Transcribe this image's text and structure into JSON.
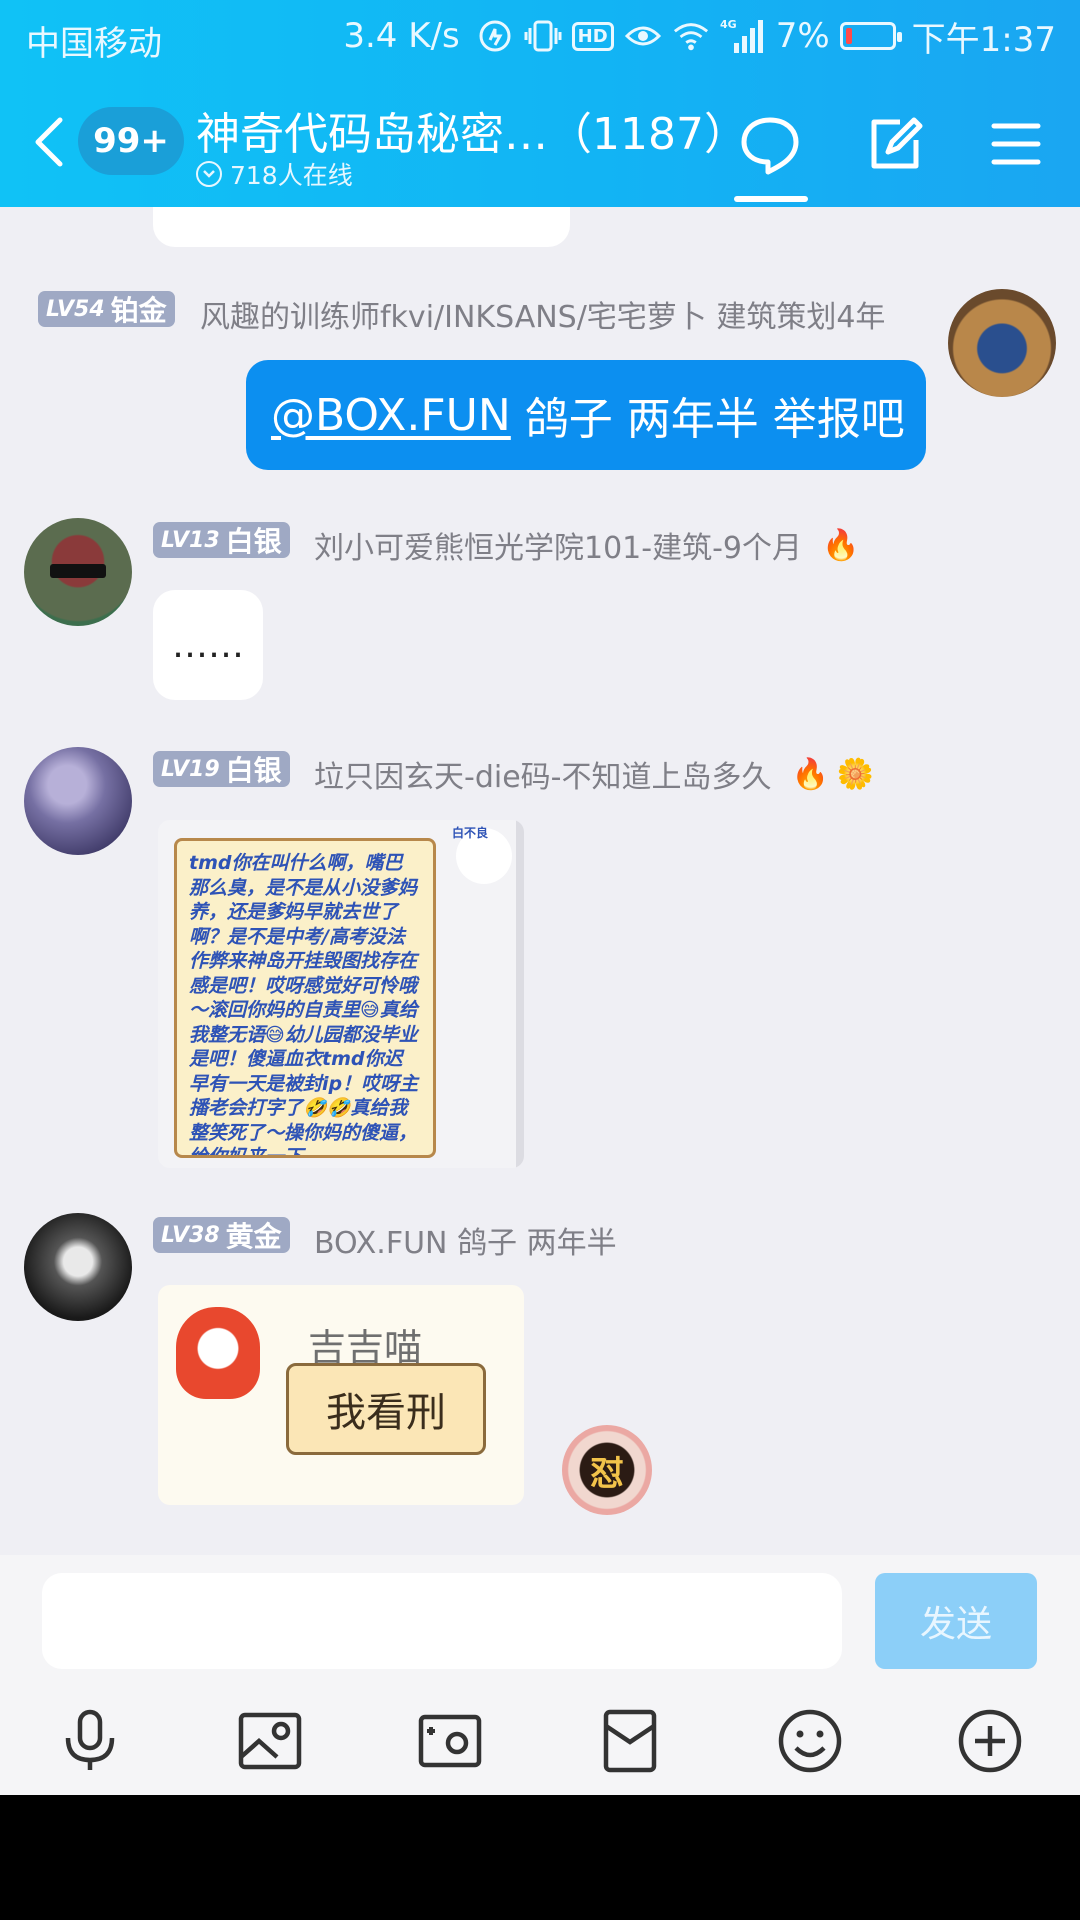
{
  "status_bar": {
    "carrier": "中国移动",
    "net_speed": "3.4 K/s",
    "hd": "HD",
    "network": "4G",
    "battery_pct": "7%",
    "time": "下午1:37"
  },
  "header": {
    "unread": "99+",
    "title": "神奇代码岛秘密…（1187）",
    "online": "718人在线"
  },
  "messages": [
    {
      "lv": "LV54",
      "rank": "铂金",
      "nick": "风趣的训练师fkvi/INKSANS/宅宅萝卜 建筑策划4年",
      "mention": "@BOX.FUN",
      "text": " 鸽子 两年半 举报吧"
    },
    {
      "lv": "LV13",
      "rank": "白银",
      "nick": "刘小可爱熊恒光学院101-建筑-9个月",
      "text": "……"
    },
    {
      "lv": "LV19",
      "rank": "白银",
      "nick": "垃只因玄天-die码-不知道上岛多久",
      "sticker_text": "tmd你在叫什么啊，嘴巴那么臭，是不是从小没爹妈养，还是爹妈早就去世了啊？是不是中考/高考没法作弊来神岛开挂毁图找存在感是吧！哎呀感觉好可怜哦～滚回你妈的自责里😅真给我整无语😅幼儿园都没毕业是吧！傻逼血衣tmd你迟早有一天是被封ip！哎呀主播老会打字了🤣🤣真给我整笑死了～操你妈的傻逼，给你妈来一下",
      "sticker_badge": "白不良"
    },
    {
      "lv": "LV38",
      "rank": "黄金",
      "nick": "BOX.FUN 鸽子 两年半",
      "sticker_title": "吉吉喵",
      "sticker_sign": "我看刑",
      "reaction": "怼"
    }
  ],
  "input": {
    "placeholder": "",
    "send_label": "发送"
  },
  "colors": {
    "header_gradient_start": "#10c2f6",
    "header_gradient_end": "#1aa6f2",
    "my_bubble": "#0c8ff0",
    "badge": "#9fa9c4",
    "send_disabled": "#8ccff8"
  }
}
